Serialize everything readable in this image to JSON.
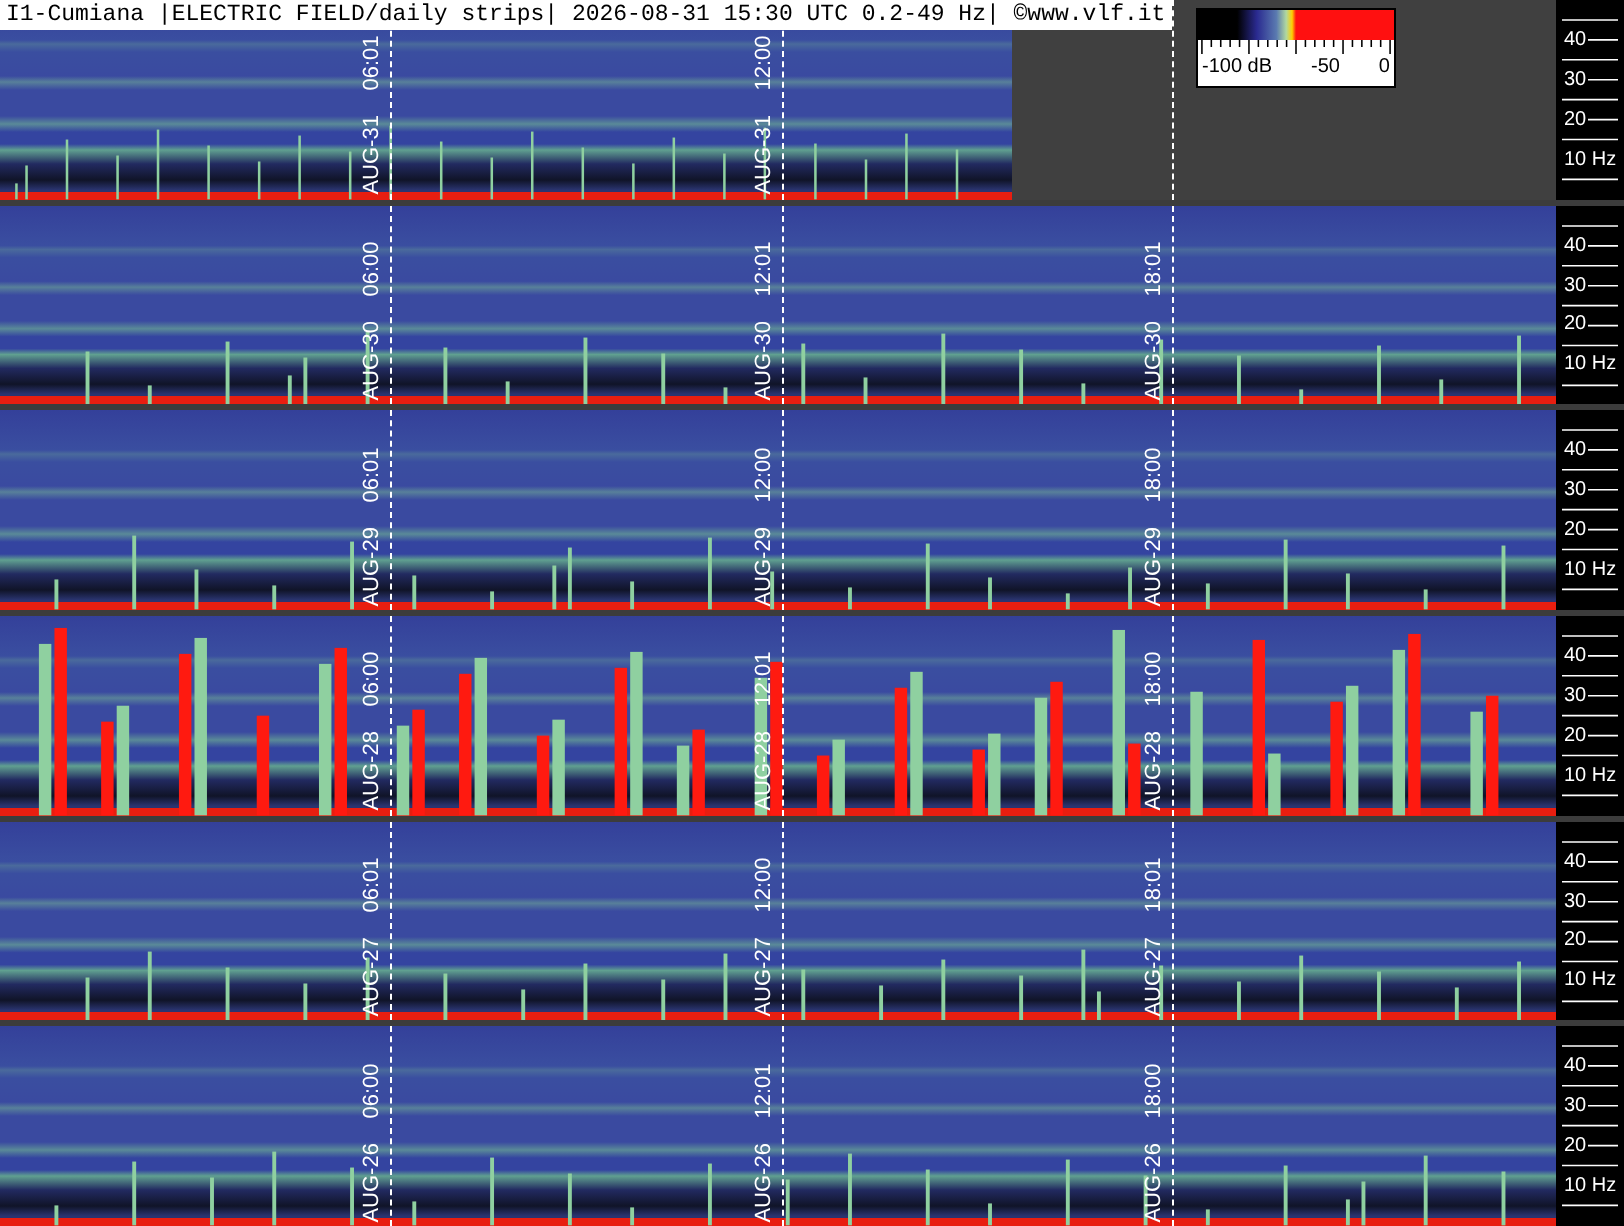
{
  "header": {
    "title": "I1-Cumiana |ELECTRIC FIELD/daily strips| 2026-08-31 15:30 UTC 0.2-49 Hz| ©www.vlf.it"
  },
  "colorbar": {
    "labels": [
      "-100 dB",
      "-50",
      "0"
    ]
  },
  "strips": [
    {
      "level": 0.65,
      "markers": [
        {
          "date": "AUG-31",
          "time": "06:01"
        },
        {
          "date": "AUG-31",
          "time": "12:00"
        }
      ],
      "axis": [
        "40",
        "30",
        "20",
        "10 Hz"
      ]
    },
    {
      "level": 1,
      "markers": [
        {
          "date": "AUG-30",
          "time": "06:00"
        },
        {
          "date": "AUG-30",
          "time": "12:01"
        },
        {
          "date": "AUG-30",
          "time": "18:01"
        }
      ],
      "axis": [
        "40",
        "30",
        "20",
        "10 Hz"
      ]
    },
    {
      "level": 1,
      "markers": [
        {
          "date": "AUG-29",
          "time": "06:01"
        },
        {
          "date": "AUG-29",
          "time": "12:00"
        },
        {
          "date": "AUG-29",
          "time": "18:00"
        }
      ],
      "axis": [
        "40",
        "30",
        "20",
        "10 Hz"
      ]
    },
    {
      "level": 1,
      "markers": [
        {
          "date": "AUG-28",
          "time": "06:00"
        },
        {
          "date": "AUG-28",
          "time": "12:01"
        },
        {
          "date": "AUG-28",
          "time": "18:00"
        }
      ],
      "axis": [
        "40",
        "30",
        "20",
        "10 Hz"
      ]
    },
    {
      "level": 1,
      "markers": [
        {
          "date": "AUG-27",
          "time": "06:01"
        },
        {
          "date": "AUG-27",
          "time": "12:00"
        },
        {
          "date": "AUG-27",
          "time": "18:01"
        }
      ],
      "axis": [
        "40",
        "30",
        "20",
        "10 Hz"
      ]
    },
    {
      "level": 1,
      "markers": [
        {
          "date": "AUG-26",
          "time": "06:00"
        },
        {
          "date": "AUG-26",
          "time": "12:01"
        },
        {
          "date": "AUG-26",
          "time": "18:00"
        }
      ],
      "axis": [
        "40",
        "30",
        "20",
        "10 Hz"
      ]
    }
  ]
}
